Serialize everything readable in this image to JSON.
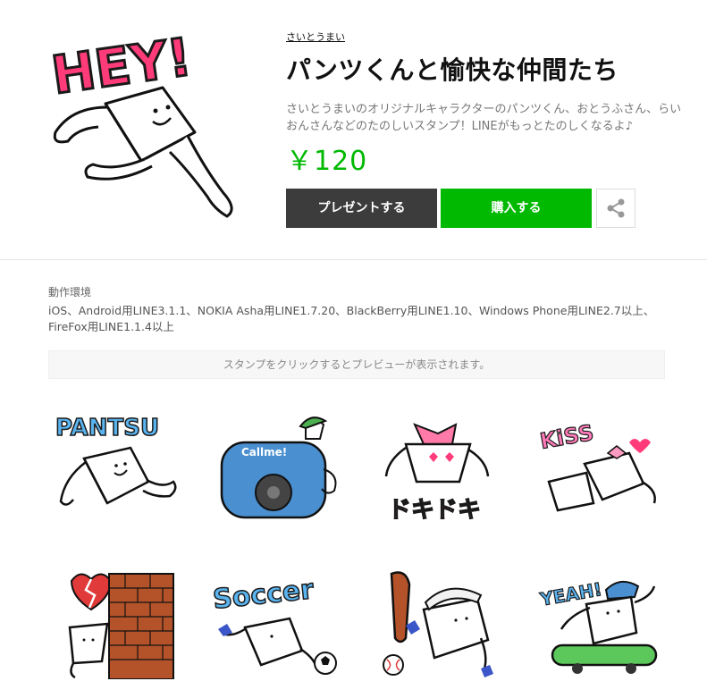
{
  "product": {
    "author": "さいとうまい",
    "title": "パンツくんと愉快な仲間たち",
    "description": "さいとうまいのオリジナルキャラクターのパンツくん、おとうふさん、らいおんさんなどのたのしいスタンプ！LINEがもっとたのしくなるよ♪",
    "price": "￥120"
  },
  "main_sticker": {
    "text": "HEY!"
  },
  "buttons": {
    "present": "プレゼントする",
    "buy": "購入する",
    "share_icon": "share-icon"
  },
  "environment": {
    "label": "動作環境",
    "text": "iOS、Android用LINE3.1.1、NOKIA Asha用LINE1.7.20、BlackBerry用LINE1.10、Windows Phone用LINE2.7以上、FireFox用LINE1.1.4以上"
  },
  "preview_hint": "スタンプをクリックするとプレビューが表示されます。",
  "stickers": [
    {
      "name": "sticker-pantsu",
      "text": "PANTSU"
    },
    {
      "name": "sticker-callme",
      "text": "Callme!"
    },
    {
      "name": "sticker-dokidoki",
      "text": "ドキドキ"
    },
    {
      "name": "sticker-kiss",
      "text": "KiSS"
    },
    {
      "name": "sticker-broken-heart",
      "text": ""
    },
    {
      "name": "sticker-soccer",
      "text": "Soccer"
    },
    {
      "name": "sticker-baseball",
      "text": ""
    },
    {
      "name": "sticker-yeah",
      "text": "YEAH!"
    }
  ],
  "colors": {
    "accent_green": "#00b900",
    "dark_button": "#3c3c3c",
    "hey_pink": "#ff3b7a",
    "pantsu_blue": "#5ab4f0"
  }
}
